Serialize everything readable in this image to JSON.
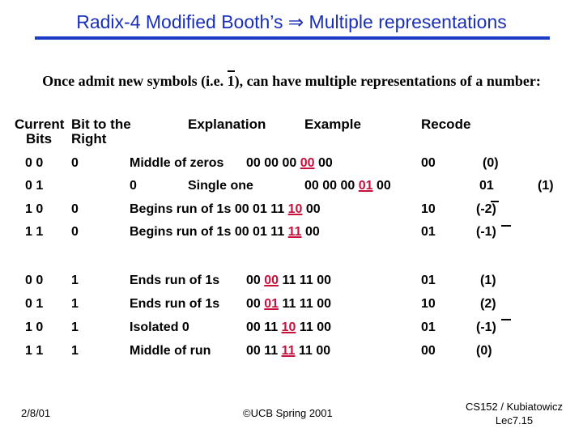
{
  "slide": {
    "title": "Radix-4 Modified Booth’s ⇒ Multiple representations",
    "subtitle_pre": "Once admit new symbols (i.e. ",
    "subtitle_bar": "1",
    "subtitle_post": "), can have multiple representations of a number:",
    "colors": {
      "title": "#1a2fb8",
      "highlight": "#c8103c"
    }
  },
  "table": {
    "headers": {
      "current_bits_1": "Current",
      "current_bits_2": "Bits",
      "bit_right_1": "Bit to the",
      "bit_right_2": "Right",
      "explanation": "Explanation",
      "example": "Example",
      "recode": "Recode"
    },
    "rows": [
      {
        "bits": "0 0",
        "right": "0",
        "explanation": "Middle of zeros",
        "ex_pre": "00 00 00 ",
        "ex_hl": "00",
        "ex_post": " 00",
        "recode": "00",
        "value": "(0)"
      },
      {
        "bits": "0 1",
        "right": "0",
        "explanation": "Single one",
        "ex_pre": "00 00 00 ",
        "ex_hl": "01",
        "ex_post": " 00",
        "recode": "01",
        "value": "(1)"
      },
      {
        "bits": "1 0",
        "right": "0",
        "explanation": "Begins run of 1s",
        "ex_pre": "00 01 11 ",
        "ex_hl": "10",
        "ex_post": " 00",
        "recode": "10",
        "value": "(-2)"
      },
      {
        "bits": "1 1",
        "right": "0",
        "explanation": "Begins run of 1s",
        "ex_pre": "00 01 11 ",
        "ex_hl": "11",
        "ex_post": " 00",
        "recode": "01",
        "value": "(-1)"
      },
      {
        "bits": "0 0",
        "right": "1",
        "explanation": "Ends run of 1s",
        "ex_pre": "00 ",
        "ex_hl": "00",
        "ex_post": " 11 11 00",
        "recode": "01",
        "value": "(1)"
      },
      {
        "bits": "0 1",
        "right": "1",
        "explanation": "Ends run of 1s",
        "ex_pre": "00 ",
        "ex_hl": "01",
        "ex_post": " 11 11 00",
        "recode": "10",
        "value": "(2)"
      },
      {
        "bits": "1 0",
        "right": "1",
        "explanation": "Isolated 0",
        "ex_pre": "00 11 ",
        "ex_hl": "10",
        "ex_post": " 11 00",
        "recode": "01",
        "value": "(-1)"
      },
      {
        "bits": "1 1",
        "right": "1",
        "explanation": "Middle of run",
        "ex_pre": "00 11 ",
        "ex_hl": "11",
        "ex_post": " 11 00",
        "recode": "00",
        "value": "(0)"
      }
    ]
  },
  "footer": {
    "date": "2/8/01",
    "copyright": "©UCB Spring 2001",
    "course": "CS152 / Kubiatowicz",
    "lecture": "Lec7.15"
  }
}
